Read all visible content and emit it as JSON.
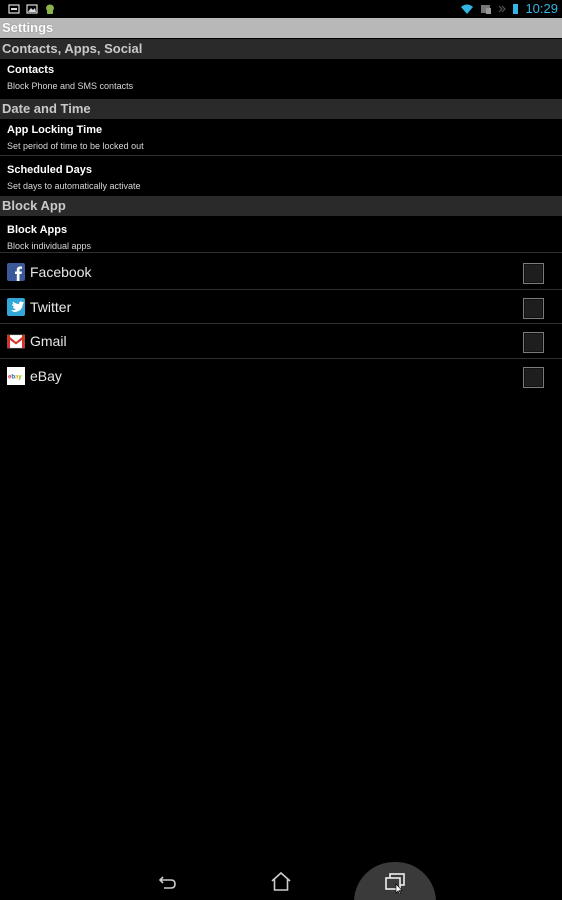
{
  "status_bar": {
    "left_icons": [
      "usb-icon",
      "image-icon",
      "android-debug-icon"
    ],
    "right_icons": [
      "wifi-icon",
      "sync-icon",
      "signal-icon",
      "battery-icon"
    ],
    "time": "10:29",
    "accent_color": "#33b5e5"
  },
  "title_bar": {
    "title": "Settings"
  },
  "sections": [
    {
      "header": "Contacts, Apps, Social",
      "items": [
        {
          "title": "Contacts",
          "summary": "Block Phone and SMS contacts"
        }
      ]
    },
    {
      "header": "Date and Time",
      "items": [
        {
          "title": "App Locking Time",
          "summary": "Set period of time to be locked out"
        },
        {
          "title": "Scheduled Days",
          "summary": "Set days to automatically activate"
        }
      ]
    },
    {
      "header": "Block App",
      "items": [
        {
          "title": "Block Apps",
          "summary": "Block individual apps"
        }
      ]
    }
  ],
  "apps": [
    {
      "name": "Facebook",
      "icon": "facebook-icon",
      "checked": false
    },
    {
      "name": "Twitter",
      "icon": "twitter-icon",
      "checked": false
    },
    {
      "name": "Gmail",
      "icon": "gmail-icon",
      "checked": false
    },
    {
      "name": "eBay",
      "icon": "ebay-icon",
      "checked": false
    }
  ],
  "nav_bar": {
    "buttons": [
      "back-icon",
      "home-icon",
      "recent-apps-icon"
    ]
  }
}
